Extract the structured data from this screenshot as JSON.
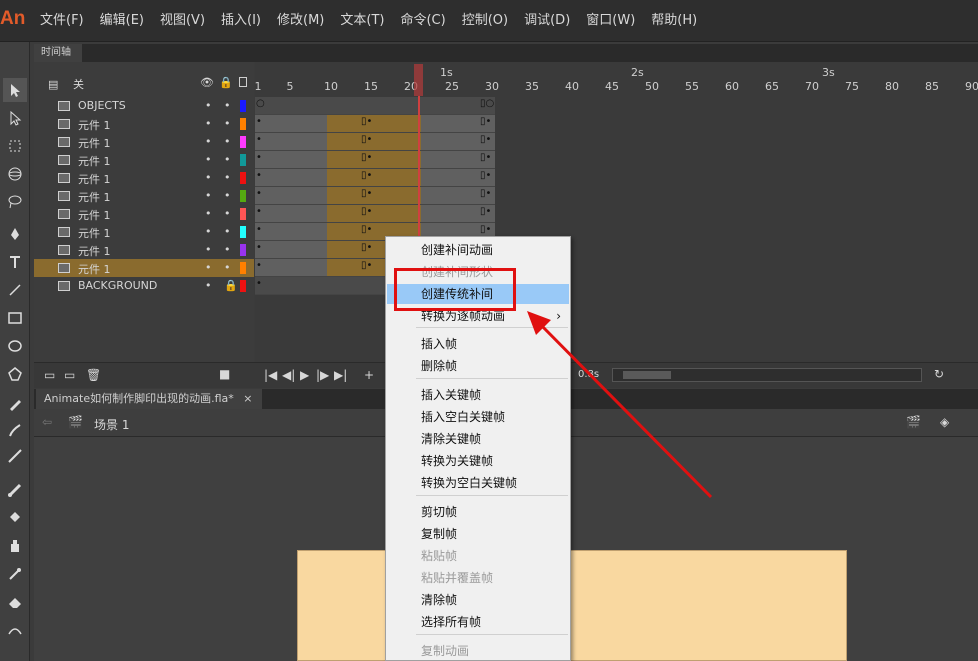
{
  "app": {
    "logo": "An"
  },
  "menubar": {
    "items": [
      "文件(F)",
      "编辑(E)",
      "视图(V)",
      "插入(I)",
      "修改(M)",
      "文本(T)",
      "命令(C)",
      "控制(O)",
      "调试(D)",
      "窗口(W)",
      "帮助(H)"
    ]
  },
  "timeline": {
    "tab_label": "时间轴",
    "header_label": "关",
    "ruler_numbers": [
      "1",
      "5",
      "10",
      "15",
      "20",
      "25",
      "30",
      "35",
      "40",
      "45",
      "50",
      "55",
      "60",
      "65",
      "70",
      "75",
      "80",
      "85",
      "90"
    ],
    "seconds": [
      "1s",
      "2s",
      "3s"
    ],
    "playhead_frame": "21",
    "layers": [
      {
        "name": "OBJECTS",
        "color": "#1a1aff"
      },
      {
        "name": "元件 1",
        "color": "#ff8000"
      },
      {
        "name": "元件 1",
        "color": "#ff3aff"
      },
      {
        "name": "元件 1",
        "color": "#119999"
      },
      {
        "name": "元件 1",
        "color": "#ee1111"
      },
      {
        "name": "元件 1",
        "color": "#55aa11"
      },
      {
        "name": "元件 1",
        "color": "#ff5555"
      },
      {
        "name": "元件 1",
        "color": "#22ffff"
      },
      {
        "name": "元件 1",
        "color": "#9933ee"
      },
      {
        "name": "元件 1",
        "color": "#ff8000",
        "selected": true
      },
      {
        "name": "BACKGROUND",
        "color": "#ee1111"
      }
    ],
    "fps_readout": "0.8s"
  },
  "document": {
    "tab_label": "Animate如何制作脚印出现的动画.fla*",
    "scene_label": "场景 1"
  },
  "context_menu": {
    "items": [
      {
        "label": "创建补间动画",
        "enabled": true
      },
      {
        "label": "创建补间形状",
        "enabled": false
      },
      {
        "label": "创建传统补间",
        "enabled": true,
        "highlighted": true
      },
      {
        "label": "转换为逐帧动画",
        "enabled": true,
        "submenu": true
      },
      {
        "label": "插入帧",
        "enabled": true
      },
      {
        "label": "删除帧",
        "enabled": true
      },
      {
        "label": "插入关键帧",
        "enabled": true
      },
      {
        "label": "插入空白关键帧",
        "enabled": true
      },
      {
        "label": "清除关键帧",
        "enabled": true
      },
      {
        "label": "转换为关键帧",
        "enabled": true
      },
      {
        "label": "转换为空白关键帧",
        "enabled": true
      },
      {
        "label": "剪切帧",
        "enabled": true
      },
      {
        "label": "复制帧",
        "enabled": true
      },
      {
        "label": "粘贴帧",
        "enabled": false
      },
      {
        "label": "粘贴并覆盖帧",
        "enabled": false
      },
      {
        "label": "清除帧",
        "enabled": true
      },
      {
        "label": "选择所有帧",
        "enabled": true
      },
      {
        "label": "复制动画",
        "enabled": false
      }
    ],
    "submenu_glyph": "›"
  },
  "colors": {
    "highlight_box": "#e01010",
    "arrow": "#e01010",
    "menu_highlight": "#99c9f7",
    "tween_span": "#8a6b2e",
    "stage": "#f9d8a0"
  }
}
